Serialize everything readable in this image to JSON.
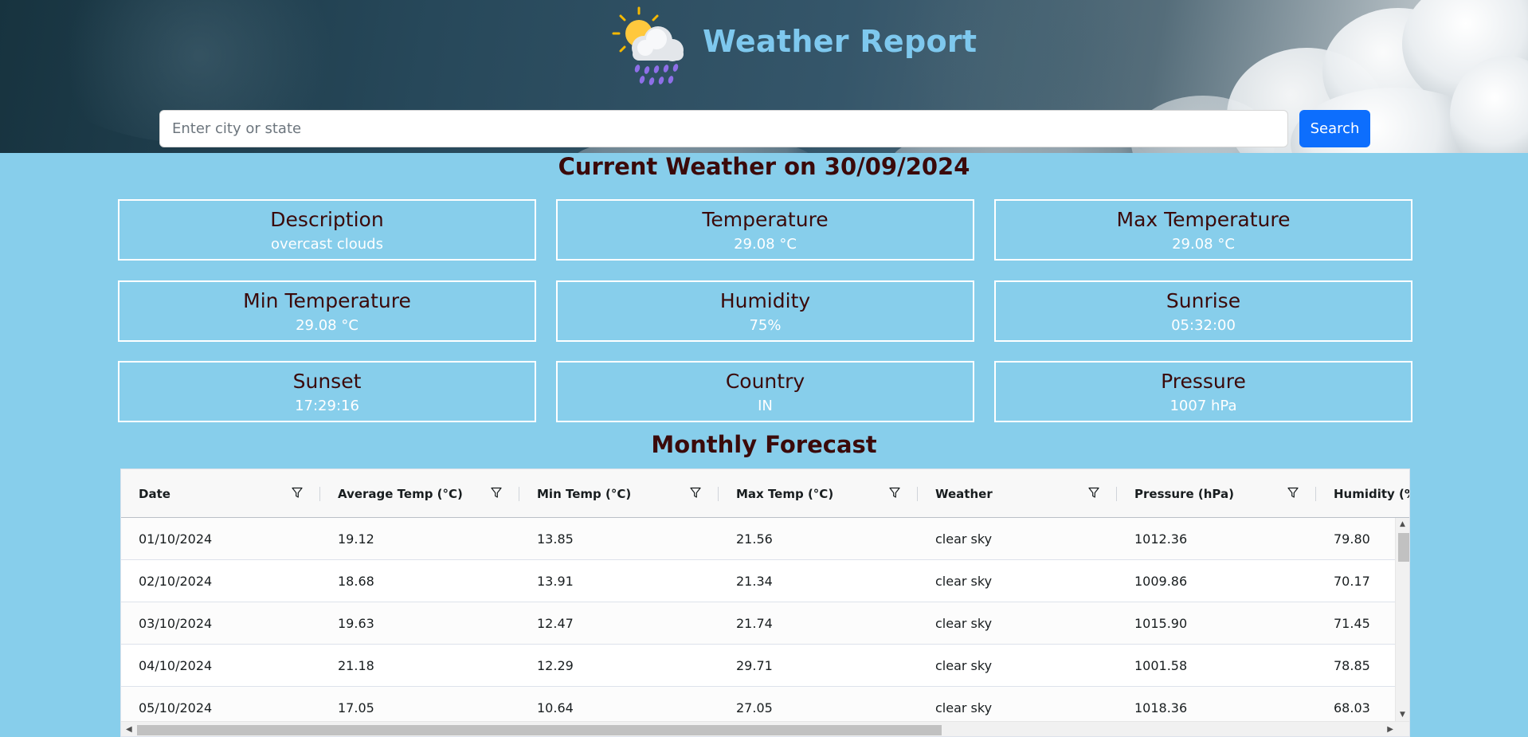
{
  "header": {
    "title": "Weather Report",
    "logo_icon": "sun-behind-rain-cloud-icon"
  },
  "search": {
    "placeholder": "Enter city or state",
    "value": "",
    "button_label": "Search"
  },
  "current": {
    "heading": "Current Weather on 30/09/2024",
    "cards": [
      {
        "label": "Description",
        "value": "overcast clouds"
      },
      {
        "label": "Temperature",
        "value": "29.08 °C"
      },
      {
        "label": "Max Temperature",
        "value": "29.08 °C"
      },
      {
        "label": "Min Temperature",
        "value": "29.08 °C"
      },
      {
        "label": "Humidity",
        "value": "75%"
      },
      {
        "label": "Sunrise",
        "value": "05:32:00"
      },
      {
        "label": "Sunset",
        "value": "17:29:16"
      },
      {
        "label": "Country",
        "value": "IN"
      },
      {
        "label": "Pressure",
        "value": "1007 hPa"
      }
    ]
  },
  "forecast": {
    "heading": "Monthly Forecast",
    "columns": [
      "Date",
      "Average Temp (°C)",
      "Min Temp (°C)",
      "Max Temp (°C)",
      "Weather",
      "Pressure (hPa)",
      "Humidity (%"
    ],
    "rows": [
      [
        "01/10/2024",
        "19.12",
        "13.85",
        "21.56",
        "clear sky",
        "1012.36",
        "79.80"
      ],
      [
        "02/10/2024",
        "18.68",
        "13.91",
        "21.34",
        "clear sky",
        "1009.86",
        "70.17"
      ],
      [
        "03/10/2024",
        "19.63",
        "12.47",
        "21.74",
        "clear sky",
        "1015.90",
        "71.45"
      ],
      [
        "04/10/2024",
        "21.18",
        "12.29",
        "29.71",
        "clear sky",
        "1001.58",
        "78.85"
      ],
      [
        "05/10/2024",
        "17.05",
        "10.64",
        "27.05",
        "clear sky",
        "1018.36",
        "68.03"
      ]
    ]
  },
  "colors": {
    "page_background": "#87ceeb",
    "title_text": "#7ec8ee",
    "heading_text": "#3b0a0a",
    "search_button": "#0d6efd",
    "card_border": "#ffffff"
  }
}
